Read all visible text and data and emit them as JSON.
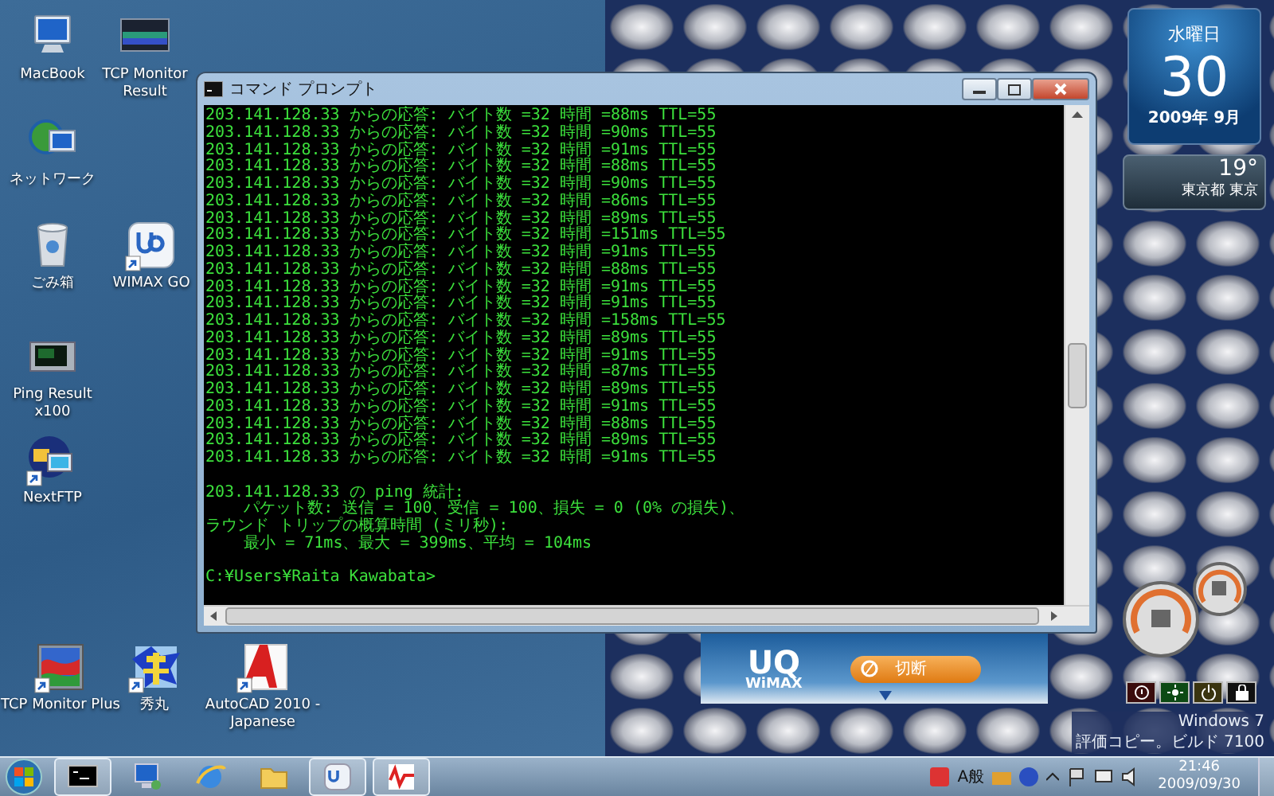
{
  "desktop_icons": [
    {
      "label": "MacBook",
      "kind": "computer",
      "shortcut": false
    },
    {
      "label": "TCP Monitor Result",
      "kind": "graph-window",
      "shortcut": false
    },
    {
      "label": "ネットワーク",
      "kind": "network",
      "shortcut": false
    },
    {
      "label": "ごみ箱",
      "kind": "trash",
      "shortcut": false
    },
    {
      "label": "WIMAX GO",
      "kind": "tile",
      "shortcut": true
    },
    {
      "label": "Ping Result x100",
      "kind": "screen",
      "shortcut": false
    },
    {
      "label": "NextFTP",
      "kind": "globe",
      "shortcut": true
    },
    {
      "label": "TCP Monitor Plus",
      "kind": "chart",
      "shortcut": true
    },
    {
      "label": "秀丸",
      "kind": "brush",
      "shortcut": true
    },
    {
      "label": "AutoCAD 2010 - Japanese",
      "kind": "cad",
      "shortcut": true
    }
  ],
  "console_window": {
    "title": "コマンド プロンプト",
    "ping_replies": [
      "203.141.128.33 からの応答: バイト数 =32 時間 =88ms TTL=55",
      "203.141.128.33 からの応答: バイト数 =32 時間 =90ms TTL=55",
      "203.141.128.33 からの応答: バイト数 =32 時間 =91ms TTL=55",
      "203.141.128.33 からの応答: バイト数 =32 時間 =88ms TTL=55",
      "203.141.128.33 からの応答: バイト数 =32 時間 =90ms TTL=55",
      "203.141.128.33 からの応答: バイト数 =32 時間 =86ms TTL=55",
      "203.141.128.33 からの応答: バイト数 =32 時間 =89ms TTL=55",
      "203.141.128.33 からの応答: バイト数 =32 時間 =151ms TTL=55",
      "203.141.128.33 からの応答: バイト数 =32 時間 =91ms TTL=55",
      "203.141.128.33 からの応答: バイト数 =32 時間 =88ms TTL=55",
      "203.141.128.33 からの応答: バイト数 =32 時間 =91ms TTL=55",
      "203.141.128.33 からの応答: バイト数 =32 時間 =91ms TTL=55",
      "203.141.128.33 からの応答: バイト数 =32 時間 =158ms TTL=55",
      "203.141.128.33 からの応答: バイト数 =32 時間 =89ms TTL=55",
      "203.141.128.33 からの応答: バイト数 =32 時間 =91ms TTL=55",
      "203.141.128.33 からの応答: バイト数 =32 時間 =87ms TTL=55",
      "203.141.128.33 からの応答: バイト数 =32 時間 =89ms TTL=55",
      "203.141.128.33 からの応答: バイト数 =32 時間 =91ms TTL=55",
      "203.141.128.33 からの応答: バイト数 =32 時間 =88ms TTL=55",
      "203.141.128.33 からの応答: バイト数 =32 時間 =89ms TTL=55",
      "203.141.128.33 からの応答: バイト数 =32 時間 =91ms TTL=55"
    ],
    "statistics": [
      "203.141.128.33 の ping 統計:",
      "    パケット数: 送信 = 100、受信 = 100、損失 = 0 (0% の損失)、",
      "ラウンド トリップの概算時間 (ミリ秒):",
      "    最小 = 71ms、最大 = 399ms、平均 = 104ms"
    ],
    "prompt": "C:¥Users¥Raita Kawabata>"
  },
  "calendar_gadget": {
    "weekday": "水曜日",
    "day": "30",
    "month": "2009年 9月"
  },
  "weather_gadget": {
    "temperature": "19°",
    "location": "東京都 東京"
  },
  "wimax_panel": {
    "logo_top": "UQ",
    "logo_bottom": "WiMAX",
    "button": "切断"
  },
  "power_buttons": [
    {
      "kind": "info"
    },
    {
      "kind": "sleep"
    },
    {
      "kind": "power"
    },
    {
      "kind": "lock"
    }
  ],
  "os_notice": [
    "Windows 7",
    "評価コピー。ビルド 7100"
  ],
  "taskbar": {
    "buttons": [
      {
        "kind": "console",
        "running": true
      },
      {
        "kind": "network",
        "running": false
      },
      {
        "kind": "browser",
        "running": false
      },
      {
        "kind": "folder",
        "running": false
      },
      {
        "kind": "tile",
        "running": true
      },
      {
        "kind": "wave",
        "running": true
      }
    ],
    "ime": "A般",
    "clock_time": "21:46",
    "clock_date": "2009/09/30"
  }
}
